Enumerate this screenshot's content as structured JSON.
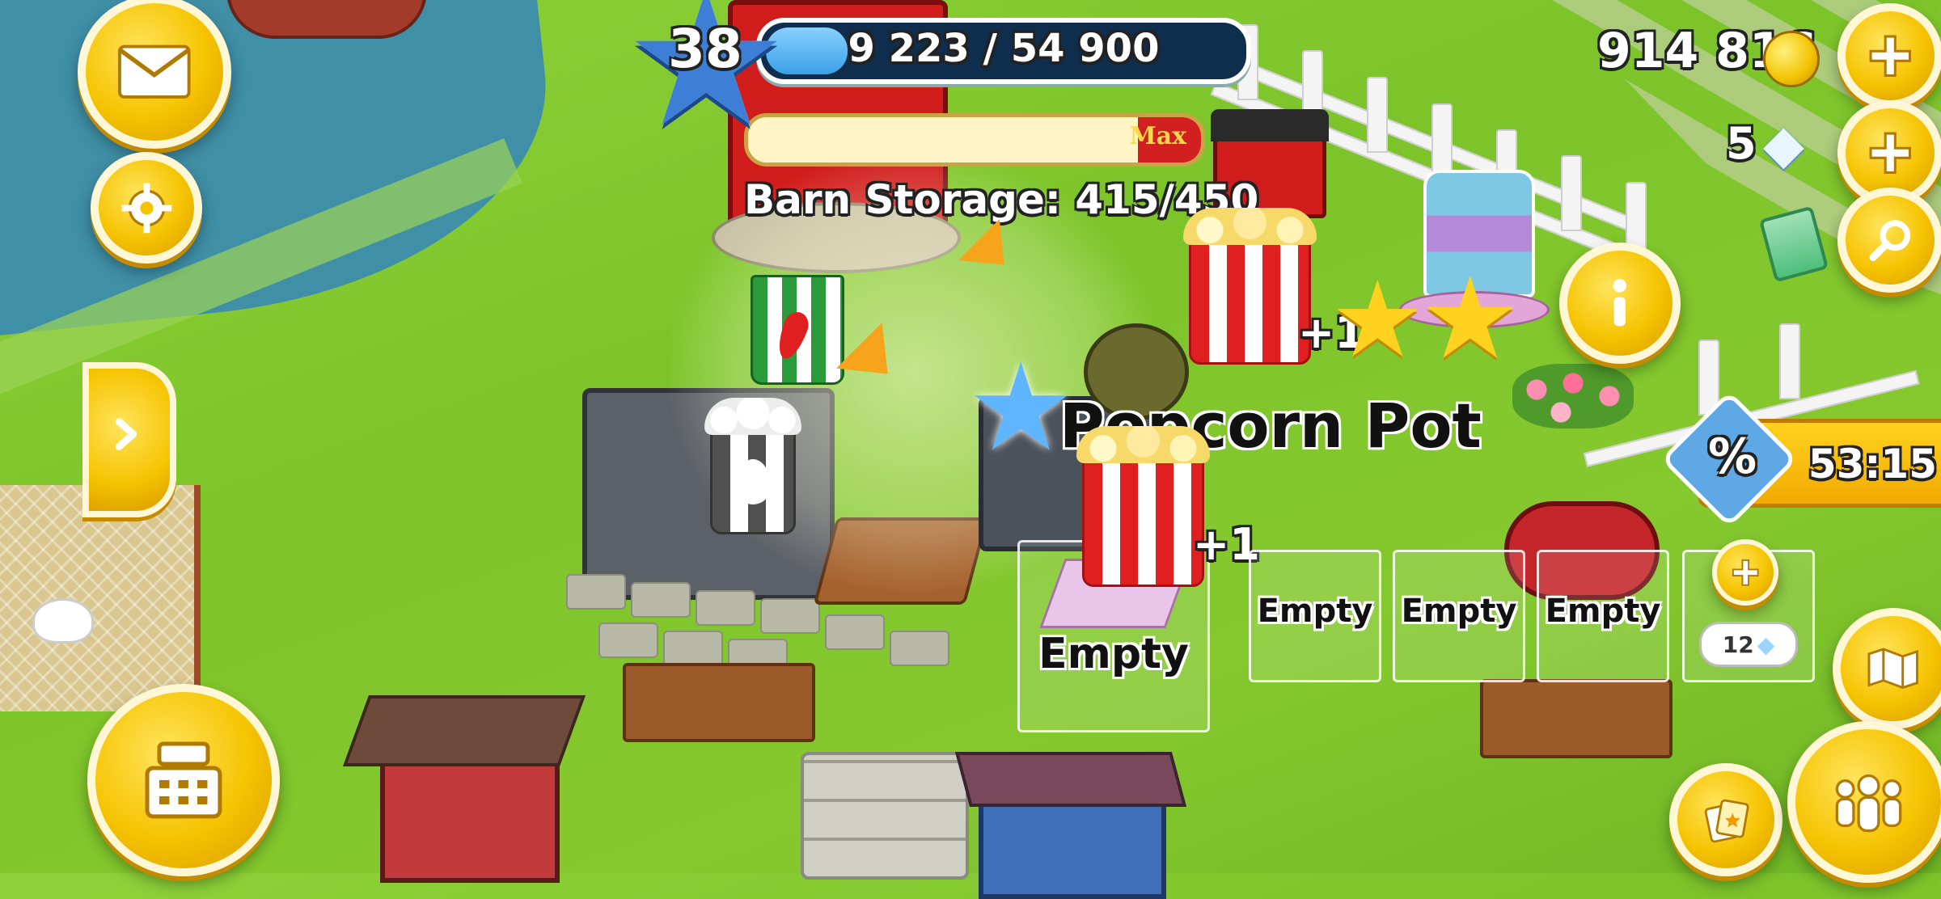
{
  "hud": {
    "level": "38",
    "xp_text": "9 223 / 54 900",
    "xp_progress": 0.168,
    "coins": "914 816",
    "diamonds": "5"
  },
  "barn": {
    "storage_label": "Barn Storage: 415/450",
    "max_label": "Max",
    "storage_fill": 0.92
  },
  "machine": {
    "name": "Popcorn Pot",
    "plus_one_a": "+1",
    "plus_one_b": "+1",
    "slots": [
      "Empty",
      "Empty",
      "Empty",
      "Empty"
    ],
    "add_slot_cost": "12"
  },
  "sale": {
    "discount_symbol": "%",
    "timer": "53:15"
  },
  "colors": {
    "grass": "#7cc42a",
    "button_gold": "#f5c300",
    "water": "#3f8fa6",
    "xp_blue": "#3aa0e6"
  },
  "icons": {
    "mail": "envelope-icon",
    "settings": "gear-icon",
    "expand": "chevron-right-icon",
    "shop": "cash-register-icon",
    "add_coins": "plus-icon",
    "add_diamonds": "plus-icon",
    "search": "magnifier-icon",
    "info": "info-icon",
    "friends": "people-icon",
    "cards": "cards-icon",
    "map": "map-icon"
  }
}
